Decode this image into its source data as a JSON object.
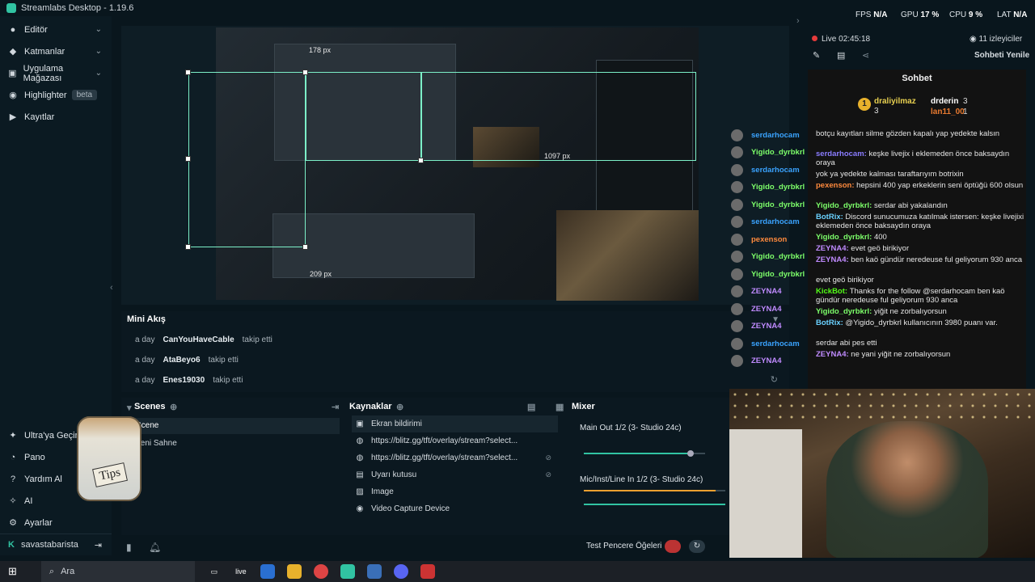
{
  "titlebar": {
    "app_title": "Streamlabs Desktop - 1.19.6"
  },
  "topstats": {
    "fps_label": "FPS",
    "fps_value": "N/A",
    "gpu_label": "GPU",
    "gpu_value": "17 %",
    "cpu_label": "CPU",
    "cpu_value": "9 %",
    "lat_label": "LAT",
    "lat_value": "N/A"
  },
  "sidebar": {
    "items": [
      {
        "label": "Editör",
        "icon": "editor-icon",
        "chevron": true
      },
      {
        "label": "Katmanlar",
        "icon": "layers-icon",
        "chevron": true
      },
      {
        "label": "Uygulama Mağazası",
        "icon": "store-icon",
        "chevron": true
      },
      {
        "label": "Highlighter",
        "icon": "highlighter-icon",
        "badge": "beta"
      },
      {
        "label": "Kayıtlar",
        "icon": "recordings-icon"
      }
    ],
    "bottom": [
      {
        "label": "Ultra'ya Geçin",
        "icon": "ultra-icon"
      },
      {
        "label": "Pano",
        "icon": "dashboard-icon"
      },
      {
        "label": "Yardım Al",
        "icon": "help-icon"
      },
      {
        "label": "AI",
        "icon": "ai-icon"
      },
      {
        "label": "Ayarlar",
        "icon": "settings-icon"
      }
    ],
    "user": "savastabarista"
  },
  "editor": {
    "width_label": "178 px",
    "right_label": "1097 px",
    "bottom_label": "209 px"
  },
  "mini_feed": {
    "title": "Mini Akış",
    "rows": [
      {
        "time": "a day",
        "user": "CanYouHaveCable",
        "action": "takip etti"
      },
      {
        "time": "a day",
        "user": "AtaBeyo6",
        "action": "takip etti"
      },
      {
        "time": "a day",
        "user": "Enes19030",
        "action": "takip etti"
      }
    ]
  },
  "scenes": {
    "title": "Scenes",
    "items": [
      "Scene",
      "Yeni Sahne"
    ]
  },
  "sources": {
    "title": "Kaynaklar",
    "items": [
      {
        "label": "Ekran bildirimi",
        "icon": "notification-icon"
      },
      {
        "label": "https://blitz.gg/tft/overlay/stream?select...",
        "icon": "globe-icon",
        "hidden": false
      },
      {
        "label": "https://blitz.gg/tft/overlay/stream?select...",
        "icon": "globe-icon",
        "hidden": true
      },
      {
        "label": "Uyarı kutusu",
        "icon": "alert-icon",
        "hidden": true
      },
      {
        "label": "Image",
        "icon": "image-icon"
      },
      {
        "label": "Video Capture Device",
        "icon": "camera-icon"
      }
    ]
  },
  "mixer": {
    "title": "Mixer",
    "channels": [
      {
        "label": "Main Out 1/2 (3- Studio 24c)",
        "level": 0.88
      },
      {
        "label": "Mic/Inst/Line In 1/2 (3- Studio 24c)",
        "level": 0.93
      }
    ]
  },
  "bottombar": {
    "test_label": "Test Pencere Öğeleri"
  },
  "stream": {
    "live_label": "Live",
    "live_time": "02:45:18",
    "viewers": "11 izleyiciler",
    "refresh_chat": "Sohbeti Yenile"
  },
  "chat": {
    "title": "Sohbet",
    "leader1_name": "draliyilmaz",
    "leader1_count": "3",
    "leader2_name": "drderin",
    "leader2_count": "3",
    "leader3_name": "lan11_00",
    "leader3_count": "1",
    "messages": [
      {
        "name": "",
        "text": "botçu kayıtları silme gözden kapalı yap yedekte kalsın",
        "color": "#e6e6e6"
      },
      {
        "name": "serdarhocam:",
        "text": "keşke livejix i eklemeden önce baksaydın oraya",
        "color": "#8a7cff"
      },
      {
        "name": "",
        "text": "yok ya yedekte kalması taraftarıyım botrixin",
        "color": "#e6e6e6"
      },
      {
        "name": "pexenson:",
        "text": "hepsini 400 yap erkeklerin seni öptüğü 600 olsun",
        "color": "#ff8a3d"
      },
      {
        "name": "Yigido_dyrbkrl:",
        "text": "serdar abi yakalandın",
        "color": "#7dff6a"
      },
      {
        "name": "BotRix:",
        "text": "Discord sunucumuza katılmak istersen: keşke livejixi eklemeden önce baksaydın oraya",
        "color": "#6ad1ff"
      },
      {
        "name": "Yigido_dyrbkrl:",
        "text": "400",
        "color": "#7dff6a"
      },
      {
        "name": "ZEYNA4:",
        "text": "evet geö birikiyor",
        "color": "#c08bff"
      },
      {
        "name": "ZEYNA4:",
        "text": "ben kaö gündür neredeuse ful geliyorum 930 anca",
        "color": "#c08bff"
      },
      {
        "name": "",
        "text": "evet geö birikiyor",
        "color": "#e6e6e6"
      },
      {
        "name": "KickBot:",
        "text": "Thanks for the follow @serdarhocam ben kaö gündür neredeuse ful geliyorum 930 anca",
        "color": "#53fc18"
      },
      {
        "name": "Yigido_dyrbkrl:",
        "text": "yiğit ne zorbalıyorsun",
        "color": "#7dff6a"
      },
      {
        "name": "BotRix:",
        "text": "@Yigido_dyrbkrl kullanıcının 3980 puanı var.",
        "color": "#6ad1ff"
      },
      {
        "name": "",
        "text": "serdar abi pes etti",
        "color": "#e6e6e6"
      },
      {
        "name": "ZEYNA4:",
        "text": "ne yani yiğit ne zorbalıyorsun",
        "color": "#c08bff"
      }
    ]
  },
  "viewers_list": [
    {
      "name": "serdarhocam",
      "color": "#3aa3ff"
    },
    {
      "name": "Yigido_dyrbkrl",
      "color": "#7dff6a"
    },
    {
      "name": "serdarhocam",
      "color": "#3aa3ff"
    },
    {
      "name": "Yigido_dyrbkrl",
      "color": "#7dff6a"
    },
    {
      "name": "Yigido_dyrbkrl",
      "color": "#7dff6a"
    },
    {
      "name": "serdarhocam",
      "color": "#3aa3ff"
    },
    {
      "name": "pexenson",
      "color": "#ff8a3d"
    },
    {
      "name": "Yigido_dyrbkrl",
      "color": "#7dff6a"
    },
    {
      "name": "Yigido_dyrbkrl",
      "color": "#7dff6a"
    },
    {
      "name": "ZEYNA4",
      "color": "#c08bff"
    },
    {
      "name": "ZEYNA4",
      "color": "#c08bff"
    },
    {
      "name": "ZEYNA4",
      "color": "#c08bff"
    },
    {
      "name": "serdarhocam",
      "color": "#3aa3ff"
    },
    {
      "name": "ZEYNA4",
      "color": "#c08bff"
    }
  ],
  "overlay": {
    "tips_label": "Tips"
  },
  "taskbar": {
    "search_placeholder": "Ara",
    "live_label": "live"
  },
  "colors": {
    "accent": "#31c3a2",
    "live": "#e53b3b",
    "background": "#09161d"
  }
}
